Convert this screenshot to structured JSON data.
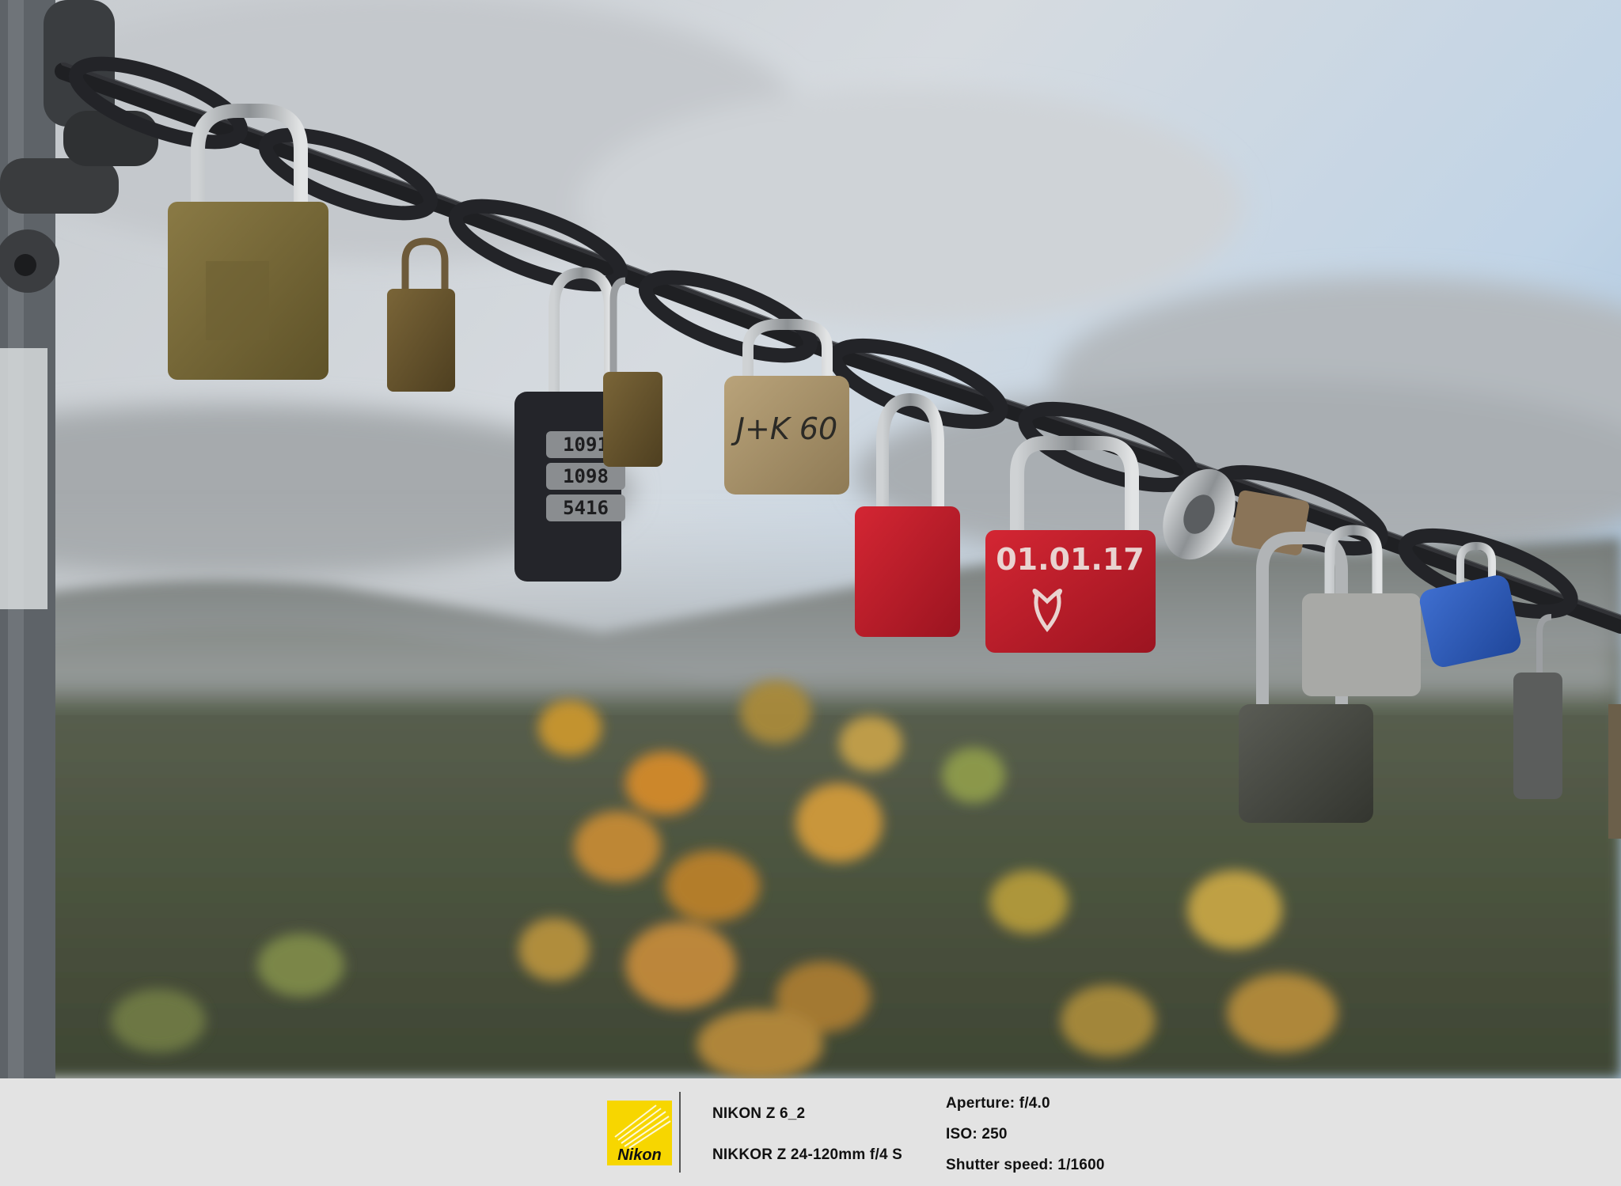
{
  "photo": {
    "subject": "padlocks",
    "locks": {
      "combo_digits": [
        "1091",
        "1098",
        "5416"
      ],
      "engraving_tan": "J+K 60",
      "engraving_red": "01.01.17"
    }
  },
  "info_bar": {
    "brand": "Nikon",
    "camera_model": "NIKON Z 6_2",
    "lens": "NIKKOR Z 24-120mm f/4 S",
    "aperture": "Aperture: f/4.0",
    "iso": "ISO: 250",
    "shutter_speed": "Shutter speed: 1/1600"
  },
  "colors": {
    "bar_background": "#e3e3e3",
    "nikon_yellow": "#f7d600",
    "lock_red": "#c41a26",
    "lock_blue": "#2a59b8"
  }
}
